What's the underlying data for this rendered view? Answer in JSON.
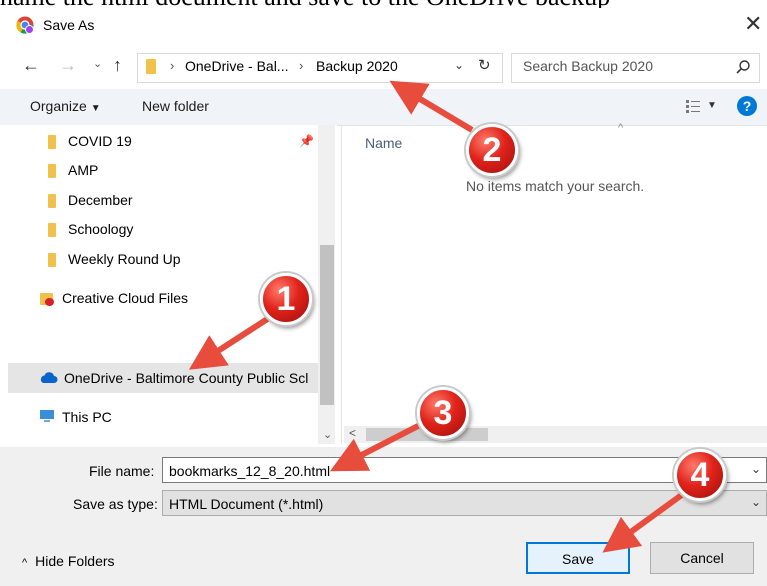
{
  "page_top_text": "name the html document and save to the OneDrive backup",
  "window": {
    "title": "Save As"
  },
  "nav": {
    "breadcrumb": [
      "OneDrive - Bal...",
      "Backup 2020"
    ],
    "search_placeholder": "Search Backup 2020"
  },
  "toolbar": {
    "organize": "Organize",
    "new_folder": "New folder"
  },
  "sidebar": {
    "items": [
      {
        "label": "COVID 19"
      },
      {
        "label": "AMP"
      },
      {
        "label": "December"
      },
      {
        "label": "Schoology"
      },
      {
        "label": "Weekly Round Up"
      },
      {
        "label": "Creative Cloud Files"
      },
      {
        "label": "OneDrive - Baltimore County Public Scl"
      },
      {
        "label": "This PC"
      }
    ]
  },
  "content": {
    "column_name": "Name",
    "empty_message": "No items match your search."
  },
  "form": {
    "file_name_label": "File name:",
    "file_name_value": "bookmarks_12_8_20.html",
    "save_type_label": "Save as type:",
    "save_type_value": "HTML Document (*.html)"
  },
  "footer": {
    "hide_folders": "Hide Folders",
    "save": "Save",
    "cancel": "Cancel"
  },
  "annotations": [
    "1",
    "2",
    "3",
    "4"
  ],
  "colors": {
    "accent": "#0078d7",
    "badge": "#e0231b",
    "toolbar_bg": "#f0f4f9",
    "folder": "#f0c14b"
  }
}
